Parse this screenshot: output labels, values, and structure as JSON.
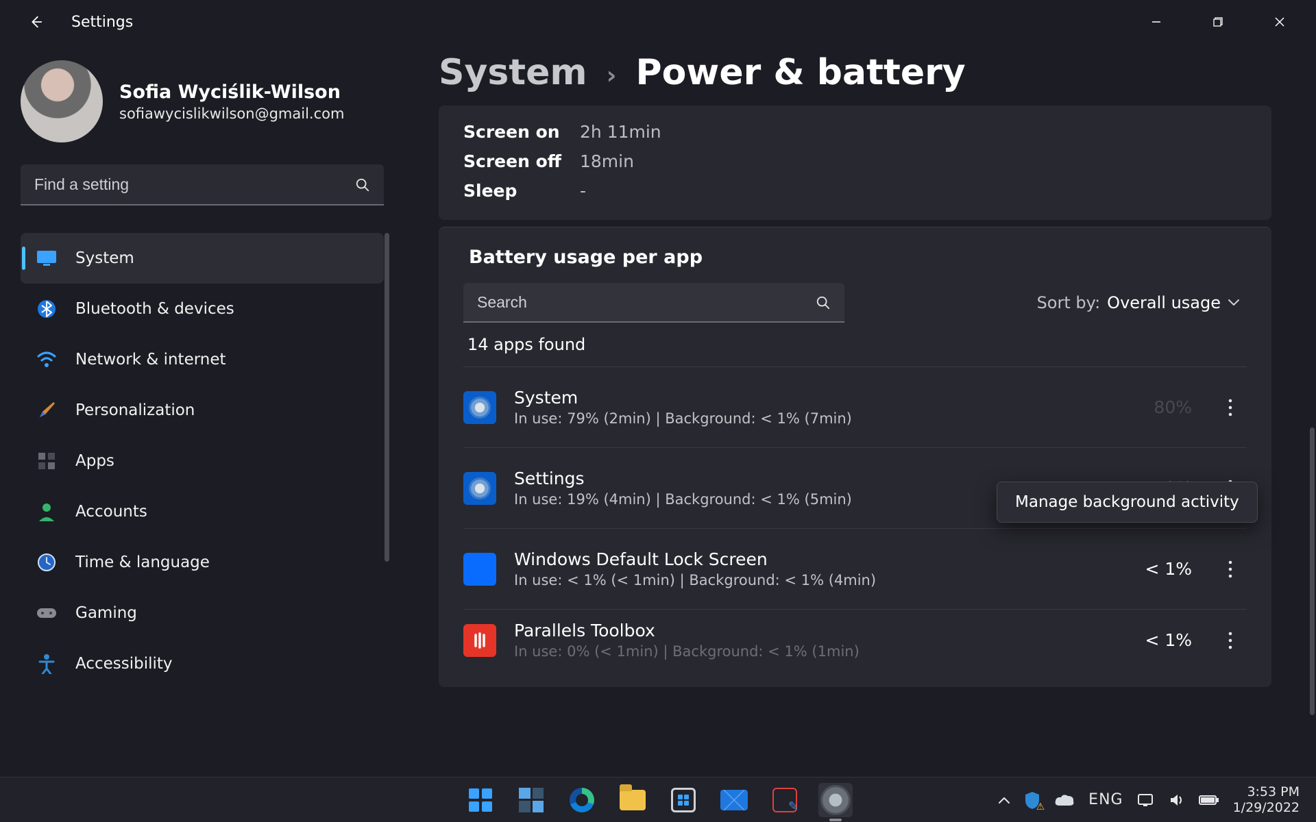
{
  "window": {
    "app_title": "Settings"
  },
  "user": {
    "name": "Sofia Wyciślik-Wilson",
    "email": "sofiawycislikwilson@gmail.com"
  },
  "sidebar": {
    "search_placeholder": "Find a setting",
    "items": [
      {
        "label": "System"
      },
      {
        "label": "Bluetooth & devices"
      },
      {
        "label": "Network & internet"
      },
      {
        "label": "Personalization"
      },
      {
        "label": "Apps"
      },
      {
        "label": "Accounts"
      },
      {
        "label": "Time & language"
      },
      {
        "label": "Gaming"
      },
      {
        "label": "Accessibility"
      }
    ]
  },
  "breadcrumb": {
    "parent": "System",
    "current": "Power & battery"
  },
  "stats": {
    "screen_on_label": "Screen on",
    "screen_on_value": "2h 11min",
    "screen_off_label": "Screen off",
    "screen_off_value": "18min",
    "sleep_label": "Sleep",
    "sleep_value": "-"
  },
  "usage": {
    "section_title": "Battery usage per app",
    "search_placeholder": "Search",
    "sort_label": "Sort by:",
    "sort_value": "Overall usage",
    "count_line": "14 apps found",
    "apps": [
      {
        "name": "System",
        "detail": "In use: 79% (2min) | Background: < 1% (7min)",
        "pct": "80%"
      },
      {
        "name": "Settings",
        "detail": "In use: 19% (4min) | Background: < 1% (5min)",
        "pct": "19%"
      },
      {
        "name": "Windows Default Lock Screen",
        "detail": "In use: < 1% (< 1min) | Background: < 1% (4min)",
        "pct": "< 1%"
      },
      {
        "name": "Parallels Toolbox",
        "detail": "In use: 0% (< 1min) | Background: < 1% (1min)",
        "pct": "< 1%"
      }
    ],
    "tooltip": "Manage background activity"
  },
  "taskbar": {
    "lang": "ENG",
    "time": "3:53 PM",
    "date": "1/29/2022"
  }
}
